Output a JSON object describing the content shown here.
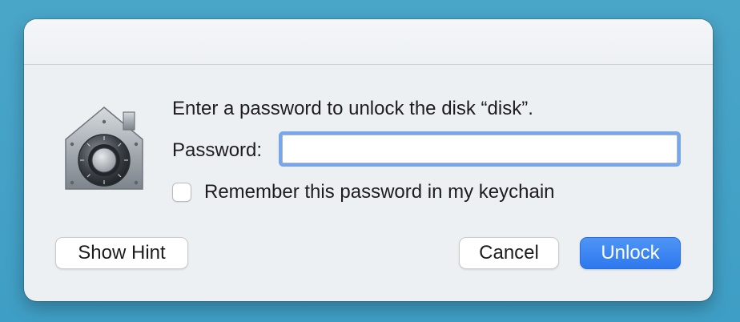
{
  "dialog": {
    "message": "Enter a password to unlock the disk “disk”.",
    "password_label": "Password:",
    "password_value": "",
    "remember_label": "Remember this password in my keychain",
    "remember_checked": false,
    "icon": "vault-lock-icon"
  },
  "buttons": {
    "show_hint": "Show Hint",
    "cancel": "Cancel",
    "unlock": "Unlock"
  },
  "colors": {
    "accent": "#2d78ee",
    "focus_ring": "#4e8de8",
    "desktop": "#4aa6c9"
  }
}
